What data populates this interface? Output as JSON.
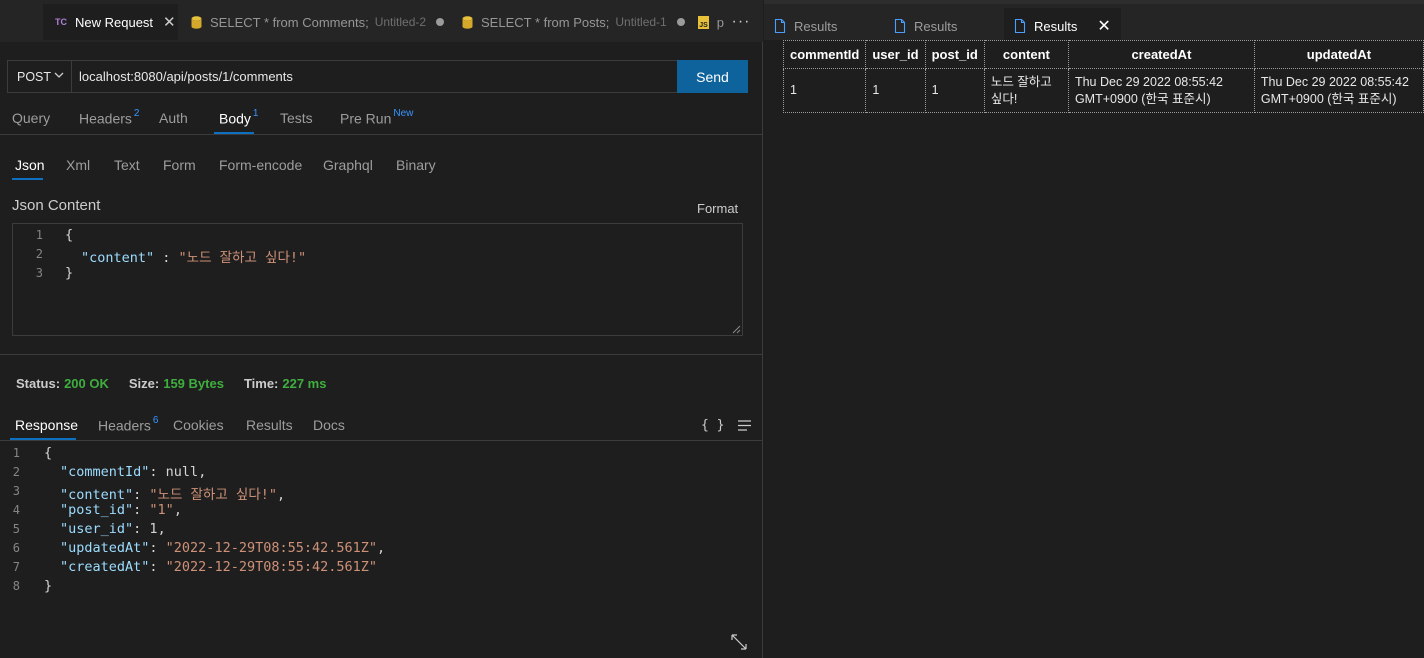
{
  "tabs": [
    {
      "icon": "tc",
      "label": "New Request",
      "sub": "",
      "close": "✕"
    },
    {
      "icon": "db",
      "label": "SELECT * from Comments;",
      "sub": "Untitled-2"
    },
    {
      "icon": "db",
      "label": "SELECT * from Posts;",
      "sub": "Untitled-1"
    },
    {
      "icon": "js",
      "label": "p",
      "js_badge": "JS"
    }
  ],
  "more_label": "···",
  "request": {
    "method": "POST",
    "url": "localhost:8080/api/posts/1/comments",
    "send_label": "Send"
  },
  "request_tabs": [
    {
      "label": "Query"
    },
    {
      "label": "Headers",
      "badge": "2"
    },
    {
      "label": "Auth"
    },
    {
      "label": "Body",
      "badge": "1"
    },
    {
      "label": "Tests"
    },
    {
      "label": "Pre Run",
      "badge": "New"
    }
  ],
  "body_types": [
    "Json",
    "Xml",
    "Text",
    "Form",
    "Form-encode",
    "Graphql",
    "Binary"
  ],
  "json_content_label": "Json Content",
  "format_label": "Format",
  "body_editor": {
    "line_numbers": [
      "1",
      "2",
      "3"
    ],
    "open": "{",
    "key": "\"content\"",
    "sep": " : ",
    "value": "\"노드 잘하고 싶다!\"",
    "close": "}"
  },
  "status": {
    "status_label": "Status:",
    "status_value": "200 OK",
    "size_label": "Size:",
    "size_value": "159 Bytes",
    "time_label": "Time:",
    "time_value": "227 ms"
  },
  "response_tabs": [
    {
      "label": "Response"
    },
    {
      "label": "Headers",
      "badge": "6"
    },
    {
      "label": "Cookies"
    },
    {
      "label": "Results"
    },
    {
      "label": "Docs"
    }
  ],
  "braces_label": "{ }",
  "response_body": {
    "line_numbers": [
      "1",
      "2",
      "3",
      "4",
      "5",
      "6",
      "7",
      "8"
    ],
    "open": "{",
    "close": "}",
    "l2_key": "\"commentId\"",
    "l2_val": "null",
    "l3_key": "\"content\"",
    "l3_val": "\"노드 잘하고 싶다!\"",
    "l4_key": "\"post_id\"",
    "l4_val": "\"1\"",
    "l5_key": "\"user_id\"",
    "l5_val": "1",
    "l6_key": "\"updatedAt\"",
    "l6_val": "\"2022-12-29T08:55:42.561Z\"",
    "l7_key": "\"createdAt\"",
    "l7_val": "\"2022-12-29T08:55:42.561Z\""
  },
  "results_tabs": [
    {
      "label": "Results"
    },
    {
      "label": "Results"
    },
    {
      "label": "Results",
      "close": "✕"
    }
  ],
  "results_table": {
    "columns": [
      "commentId",
      "user_id",
      "post_id",
      "content",
      "createdAt",
      "updatedAt"
    ],
    "rows": [
      [
        "1",
        "1",
        "1",
        "노드 잘하고 싶다!",
        "Thu Dec 29 2022 08:55:42 GMT+0900 (한국 표준시)",
        "Thu Dec 29 2022 08:55:42 GMT+0900 (한국 표준시)"
      ]
    ]
  },
  "colors": {
    "accent": "#0e639c",
    "status_ok": "#3fae3f",
    "json_key": "#9cdcfe",
    "json_string": "#ce9178",
    "badge": "#3794ff"
  }
}
